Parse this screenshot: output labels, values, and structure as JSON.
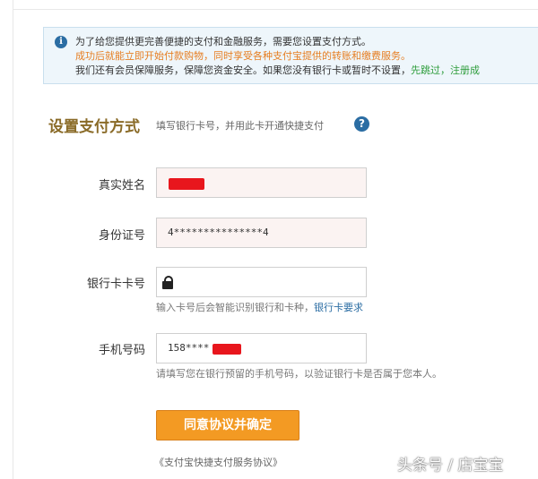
{
  "notice": {
    "line1": "为了给您提供更完善便捷的支付和金融服务，需要您设置支付方式。",
    "line2": "成功后就能立即开始付款购物，同时享受各种支付宝提供的转账和缴费服务。",
    "line3_text": "我们还有会员保障服务，保障您资金安全。如果您没有银行卡或暂时不设置，",
    "line3_link": "先跳过，注册成"
  },
  "section": {
    "title": "设置支付方式",
    "subtitle": "填写银行卡号，并用此卡开通快捷支付",
    "help_glyph": "?"
  },
  "form": {
    "name_label": "真实姓名",
    "id_label": "身份证号",
    "id_value": "4***************4",
    "card_label": "银行卡卡号",
    "card_hint": "输入卡号后会智能识别银行和卡种，",
    "card_hint_link": "银行卡要求",
    "phone_label": "手机号码",
    "phone_value": "158****",
    "phone_hint": "请填写您在银行预留的手机号码，以验证银行卡是否属于您本人。"
  },
  "submit_label": "同意协议并确定",
  "agreement_link": "《支付宝快捷支付服务协议》",
  "watermark": "头条号 / 店宝宝",
  "colors": {
    "accent_orange": "#f39a23",
    "title_brown": "#8a6b28",
    "info_blue": "#2b6da3",
    "redaction": "#e8161d"
  }
}
